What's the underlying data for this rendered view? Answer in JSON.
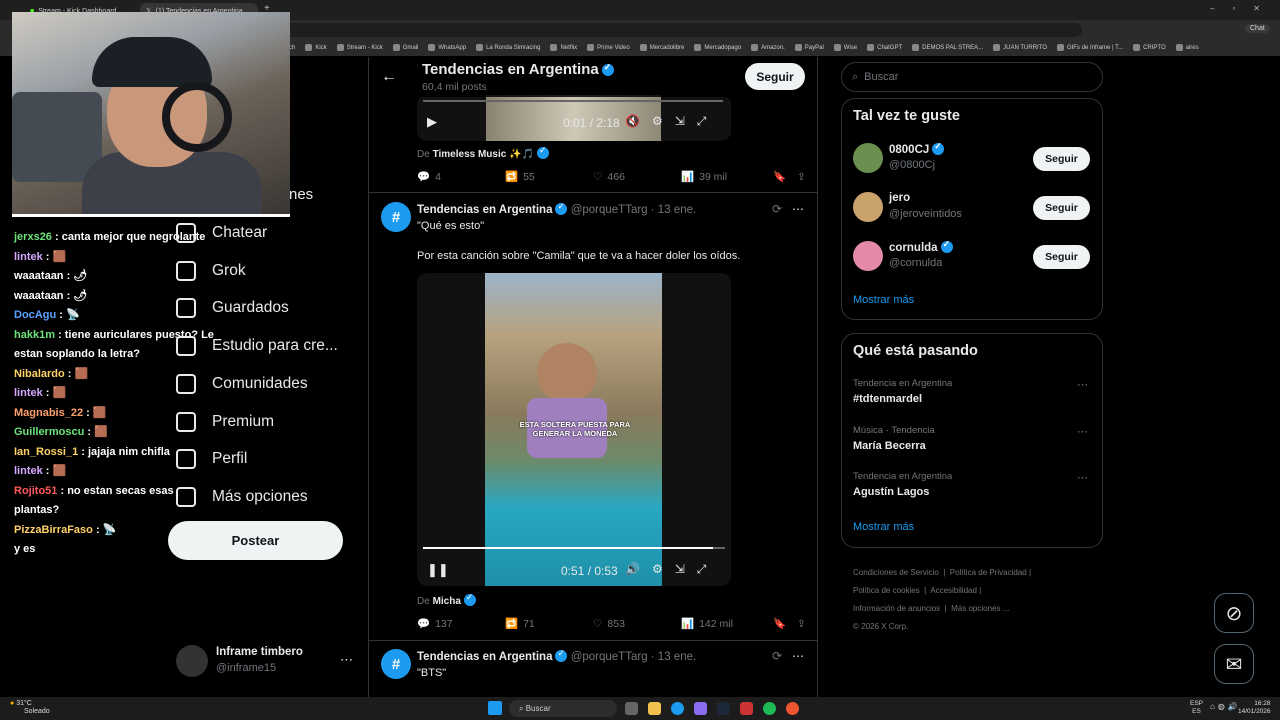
{
  "browser": {
    "tabs": [
      {
        "label": "Stream - Kick Dashboard"
      },
      {
        "label": "(1) Tendencias en Argentina"
      }
    ],
    "bookmarks": [
      "itch",
      "Kick",
      "Stream - Kick",
      "Gmail",
      "WhatsApp",
      "La Ronda Simracing",
      "Netflix",
      "Prime Video",
      "Mercadolibre",
      "Mercadopago",
      "Amazon.",
      "PayPal",
      "Wise",
      "ChatGPT",
      "DEMOS PAL STREA...",
      "JUAN TURRITO",
      "GIFs de Inframe | T...",
      "CRIPTO",
      "aires"
    ]
  },
  "webcam_overlay_text": "nes",
  "chat": [
    {
      "user": "jerxs26",
      "color": "#6ce37a",
      "text": ": canta mejor que negrolante"
    },
    {
      "user": "lintek",
      "color": "#d6a8ff",
      "text": ": 🟫"
    },
    {
      "user": "waaataan",
      "color": "#ffffff",
      "text": ": 🌶"
    },
    {
      "user": "waaataan",
      "color": "#ffffff",
      "text": ": 🌶"
    },
    {
      "user": "DocAgu",
      "color": "#5aa2ff",
      "text": ": 📡"
    },
    {
      "user": "hakk1m",
      "color": "#6ce37a",
      "text": ": tiene auriculares puesto? Le estan soplando la letra?"
    },
    {
      "user": "Nibalardo",
      "color": "#ffd166",
      "text": ": 🟫"
    },
    {
      "user": "lintek",
      "color": "#d6a8ff",
      "text": ": 🟫"
    },
    {
      "user": "Magnabis_22",
      "color": "#ff9f6e",
      "text": ": 🟫"
    },
    {
      "user": "Guillermoscu",
      "color": "#6ce37a",
      "text": ": 🟫"
    },
    {
      "user": "Ian_Rossi_1",
      "color": "#ffd166",
      "text": ": jajaja nim chifla"
    },
    {
      "user": "lintek",
      "color": "#d6a8ff",
      "text": ": 🟫"
    },
    {
      "user": "Rojito51",
      "color": "#ff5a5a",
      "text": ": no estan secas esas plantas?"
    },
    {
      "user": "PizzaBirraFaso",
      "color": "#ffd166",
      "text": ": 📡"
    },
    {
      "user": "",
      "color": "#ffffff",
      "text": "y es"
    }
  ],
  "nav": {
    "items": [
      "Chatear",
      "Grok",
      "Guardados",
      "Estudio para cre...",
      "Comunidades",
      "Premium",
      "Perfil",
      "Más opciones"
    ],
    "post_label": "Postear",
    "account_name": "Inframe timbero",
    "account_handle": "@inframe15"
  },
  "header": {
    "title": "Tendencias en Argentina",
    "subtitle": "60,4 mil posts",
    "follow_label": "Seguir"
  },
  "posts": [
    {
      "video_time": "0:01 / 2:18",
      "from_label": "De",
      "from_name": "Timeless Music ✨🎵",
      "replies": "4",
      "reposts": "55",
      "likes": "466",
      "views": "39 mil"
    },
    {
      "author": "Tendencias en Argentina",
      "handle": "@porqueTTarg",
      "date": "· 13 ene.",
      "text1": "\"Qué es esto\"",
      "text2": "Por esta canción sobre \"Camila\" que te va a hacer doler los oídos.",
      "video_caption": "ESTA SOLTERA PUESTA PARA GENERAR LA MONEDA",
      "video_time": "0:51 / 0:53",
      "video_progress": 0.96,
      "from_label": "De",
      "from_name": "Micha",
      "replies": "137",
      "reposts": "71",
      "likes": "853",
      "views": "142 mil"
    },
    {
      "author": "Tendencias en Argentina",
      "handle": "@porqueTTarg",
      "date": "· 13 ene.",
      "text1": "\"BTS\""
    }
  ],
  "right": {
    "search_placeholder": "Buscar",
    "suggest_title": "Tal vez te guste",
    "suggestions": [
      {
        "name": "0800CJ",
        "handle": "@0800Cj",
        "verified": true,
        "button": "Seguir"
      },
      {
        "name": "jero",
        "handle": "@jeroveintidos",
        "verified": false,
        "button": "Seguir"
      },
      {
        "name": "cornulda",
        "handle": "@cornulda",
        "verified": true,
        "button": "Seguir"
      }
    ],
    "show_more": "Mostrar más",
    "trends_title": "Qué está pasando",
    "trends": [
      {
        "context": "Tendencia en Argentina",
        "name": "#tdtenmardel"
      },
      {
        "context": "Música · Tendencia",
        "name": "María Becerra"
      },
      {
        "context": "Tendencia en Argentina",
        "name": "Agustín Lagos"
      }
    ],
    "trends_more": "Mostrar más",
    "footer": [
      "Condiciones de Servicio",
      "Política de Privacidad",
      "Política de cookies",
      "Accesibilidad",
      "Información de anuncios",
      "Más opciones ...",
      "© 2026 X Corp."
    ]
  },
  "taskbar": {
    "weather_temp": "31°C",
    "weather_desc": "Soleado",
    "search_label": "Buscar",
    "lang": "ESP",
    "lang2": "ES",
    "time": "16:28",
    "date": "14/01/2026"
  },
  "colors": {
    "accent": "#1d9bf0",
    "bg": "#000000",
    "border": "#2f3336"
  }
}
